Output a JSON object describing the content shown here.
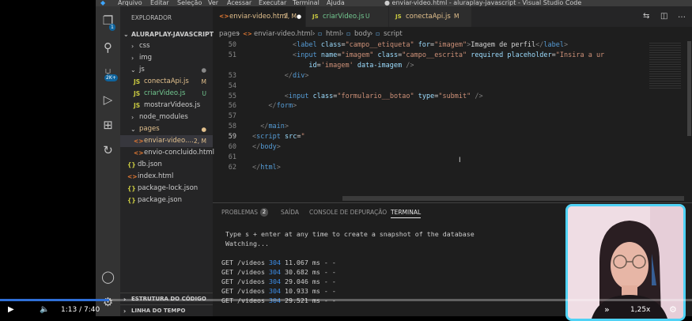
{
  "window": {
    "menu": [
      "Arquivo",
      "Editar",
      "Seleção",
      "Ver",
      "Acessar",
      "Executar",
      "Terminal",
      "Ajuda"
    ],
    "title": "● enviar-video.html - aluraplay-javascript - Visual Studio Code"
  },
  "activity_bar": {
    "source_control_badge": "2K+",
    "explorer_badge": "1"
  },
  "sidebar": {
    "header": "EXPLORADOR",
    "project": "ALURAPLAY-JAVASCRIPT",
    "items": [
      {
        "label": "css",
        "type": "folder"
      },
      {
        "label": "img",
        "type": "folder"
      },
      {
        "label": "js",
        "type": "folder-open"
      },
      {
        "label": "conectaApi.js",
        "type": "js",
        "status": "M"
      },
      {
        "label": "criarVideo.js",
        "type": "js",
        "status": "U"
      },
      {
        "label": "mostrarVideos.js",
        "type": "js",
        "status": ""
      },
      {
        "label": "node_modules",
        "type": "folder"
      },
      {
        "label": "pages",
        "type": "folder-open"
      },
      {
        "label": "enviar-video....",
        "type": "html",
        "status": "2, M"
      },
      {
        "label": "envio-concluido.html",
        "type": "html",
        "status": ""
      },
      {
        "label": "db.json",
        "type": "json"
      },
      {
        "label": "index.html",
        "type": "html"
      },
      {
        "label": "package-lock.json",
        "type": "json"
      },
      {
        "label": "package.json",
        "type": "json"
      }
    ],
    "outline": "ESTRUTURA DO CÓDIGO",
    "timeline": "LINHA DO TEMPO"
  },
  "tabs": [
    {
      "label": "enviar-video.html",
      "status": "2, M",
      "active": true
    },
    {
      "label": "criarVideo.js",
      "status": "U",
      "active": false
    },
    {
      "label": "conectaApi.js",
      "status": "M",
      "active": false
    }
  ],
  "breadcrumb": [
    "pages",
    "enviar-video.html",
    "html",
    "body",
    "script"
  ],
  "code_lines": [
    {
      "n": "50",
      "indent": 10,
      "parts": [
        [
          "tg",
          "<"
        ],
        [
          "tn",
          "label"
        ],
        [
          "tx",
          " "
        ],
        [
          "at",
          "class"
        ],
        [
          "tx",
          "="
        ],
        [
          "sv",
          "\"campo__etiqueta\""
        ],
        [
          "tx",
          " "
        ],
        [
          "at",
          "for"
        ],
        [
          "tx",
          "="
        ],
        [
          "sv",
          "\"imagem\""
        ],
        [
          "tg",
          ">"
        ],
        [
          "tx",
          "Imagem de perfil"
        ],
        [
          "tg",
          "</"
        ],
        [
          "tn",
          "label"
        ],
        [
          "tg",
          ">"
        ]
      ]
    },
    {
      "n": "51",
      "indent": 10,
      "parts": [
        [
          "tg",
          "<"
        ],
        [
          "tn",
          "input"
        ],
        [
          "tx",
          " "
        ],
        [
          "at",
          "name"
        ],
        [
          "tx",
          "="
        ],
        [
          "sv",
          "\"imagem\""
        ],
        [
          "tx",
          " "
        ],
        [
          "at",
          "class"
        ],
        [
          "tx",
          "="
        ],
        [
          "sv",
          "\"campo__escrita\""
        ],
        [
          "tx",
          " "
        ],
        [
          "at",
          "required"
        ],
        [
          "tx",
          " "
        ],
        [
          "at",
          "placeholder"
        ],
        [
          "tx",
          "="
        ],
        [
          "sv",
          "\"Insira a ur"
        ]
      ]
    },
    {
      "n": "",
      "indent": 14,
      "parts": [
        [
          "at",
          "id"
        ],
        [
          "tx",
          "="
        ],
        [
          "sv",
          "'imagem'"
        ],
        [
          "tx",
          " "
        ],
        [
          "at",
          "data-imagem"
        ],
        [
          "tx",
          " "
        ],
        [
          "tg",
          "/>"
        ]
      ]
    },
    {
      "n": "53",
      "indent": 8,
      "parts": [
        [
          "tg",
          "</"
        ],
        [
          "tn",
          "div"
        ],
        [
          "tg",
          ">"
        ]
      ]
    },
    {
      "n": "54",
      "indent": 0,
      "parts": []
    },
    {
      "n": "55",
      "indent": 8,
      "parts": [
        [
          "tg",
          "<"
        ],
        [
          "tn",
          "input"
        ],
        [
          "tx",
          " "
        ],
        [
          "at",
          "class"
        ],
        [
          "tx",
          "="
        ],
        [
          "sv",
          "\"formulario__botao\""
        ],
        [
          "tx",
          " "
        ],
        [
          "at",
          "type"
        ],
        [
          "tx",
          "="
        ],
        [
          "sv",
          "\"submit\""
        ],
        [
          "tx",
          " "
        ],
        [
          "tg",
          "/>"
        ]
      ]
    },
    {
      "n": "56",
      "indent": 4,
      "parts": [
        [
          "tg",
          "</"
        ],
        [
          "tn",
          "form"
        ],
        [
          "tg",
          ">"
        ]
      ]
    },
    {
      "n": "57",
      "indent": 0,
      "parts": []
    },
    {
      "n": "58",
      "indent": 2,
      "parts": [
        [
          "tg",
          "</"
        ],
        [
          "tn",
          "main"
        ],
        [
          "tg",
          ">"
        ]
      ]
    },
    {
      "n": "59",
      "indent": 0,
      "parts": [
        [
          "tg",
          "<"
        ],
        [
          "tn",
          "script"
        ],
        [
          "tx",
          " "
        ],
        [
          "at",
          "src"
        ],
        [
          "tx",
          "="
        ],
        [
          "sv",
          "\""
        ]
      ]
    },
    {
      "n": "60",
      "indent": 0,
      "parts": [
        [
          "tg",
          "</"
        ],
        [
          "tn",
          "body"
        ],
        [
          "tg",
          ">"
        ]
      ]
    },
    {
      "n": "61",
      "indent": 0,
      "parts": []
    },
    {
      "n": "62",
      "indent": 0,
      "parts": [
        [
          "tg",
          "</"
        ],
        [
          "tn",
          "html"
        ],
        [
          "tg",
          ">"
        ]
      ]
    }
  ],
  "panel": {
    "tabs": [
      {
        "label": "PROBLEMAS",
        "badge": "2"
      },
      {
        "label": "SAÍDA"
      },
      {
        "label": "CONSOLE DE DEPURAÇÃO"
      },
      {
        "label": "TERMINAL",
        "active": true
      }
    ],
    "terminal_lines": [
      {
        "text": " Type s + enter at any time to create a snapshot of the database"
      },
      {
        "text": " Watching..."
      },
      {
        "text": ""
      },
      {
        "pre": "GET /videos ",
        "num": "304",
        "post": " 11.067 ms - -"
      },
      {
        "pre": "GET /videos ",
        "num": "304",
        "post": " 30.682 ms - -"
      },
      {
        "pre": "GET /videos ",
        "num": "304",
        "post": " 29.046 ms - -"
      },
      {
        "pre": "GET /videos ",
        "num": "304",
        "post": " 10.933 ms - -"
      },
      {
        "pre": "GET /videos ",
        "num": "304",
        "post": " 29.521 ms - -"
      }
    ]
  },
  "video": {
    "current_time": "1:13",
    "separator": "/",
    "duration": "7:40",
    "progress": 0.158,
    "speed": "1,25x"
  },
  "colors": {
    "accent": "#2f6fd6",
    "webcam_border": "#4fd2f5"
  }
}
